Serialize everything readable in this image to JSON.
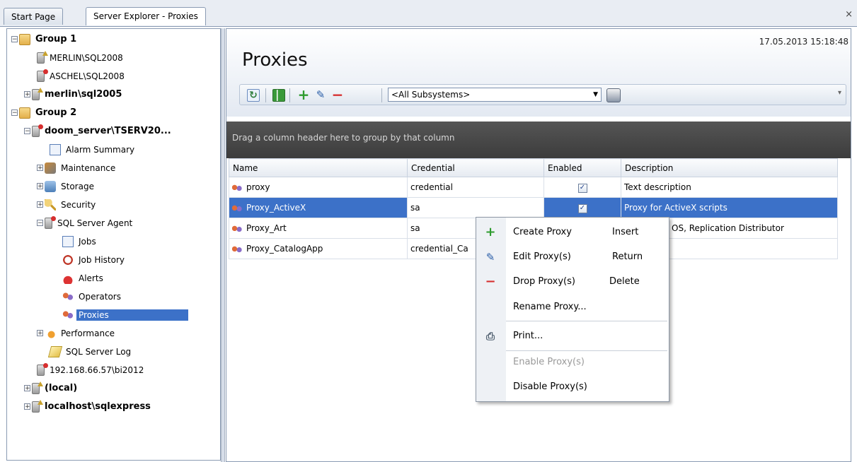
{
  "tabs": [
    {
      "label": "Start Page"
    },
    {
      "label": "Server Explorer - Proxies"
    }
  ],
  "close_glyph": "×",
  "tree": {
    "nodes": [
      {
        "label": "Group 1",
        "icon": "folder-icon",
        "bold": true,
        "expander": "−"
      },
      {
        "label": "MERLIN\\SQL2008",
        "icon": "server-icon",
        "bold": false
      },
      {
        "label": "ASCHEL\\SQL2008",
        "icon": "server-error-icon",
        "bold": false
      },
      {
        "label": "merlin\\sql2005",
        "icon": "server-icon",
        "bold": true,
        "expander": "+"
      },
      {
        "label": "Group 2",
        "icon": "folder-icon",
        "bold": true,
        "expander": "−"
      },
      {
        "label": "doom_server\\TSERV20...",
        "icon": "server-error-icon",
        "bold": true,
        "expander": "−"
      },
      {
        "label": "Alarm Summary",
        "icon": "alarm-summary-icon",
        "bold": false
      },
      {
        "label": "Maintenance",
        "icon": "wrench-icon",
        "bold": false,
        "expander": "+"
      },
      {
        "label": "Storage",
        "icon": "storage-icon",
        "bold": false,
        "expander": "+"
      },
      {
        "label": "Security",
        "icon": "key-icon",
        "bold": false,
        "expander": "+"
      },
      {
        "label": "SQL Server Agent",
        "icon": "agent-icon",
        "bold": false,
        "expander": "−"
      },
      {
        "label": "Jobs",
        "icon": "jobs-icon",
        "bold": false
      },
      {
        "label": "Job History",
        "icon": "job-history-icon",
        "bold": false
      },
      {
        "label": "Alerts",
        "icon": "alert-icon",
        "bold": false
      },
      {
        "label": "Operators",
        "icon": "operators-icon",
        "bold": false
      },
      {
        "label": "Proxies",
        "icon": "proxies-icon",
        "bold": false,
        "selected": true
      },
      {
        "label": "Performance",
        "icon": "performance-icon",
        "bold": false,
        "expander": "+"
      },
      {
        "label": "SQL Server Log",
        "icon": "log-icon",
        "bold": false
      },
      {
        "label": "192.168.66.57\\bi2012",
        "icon": "server-error-icon",
        "bold": false
      },
      {
        "label": "(local)",
        "icon": "server-icon",
        "bold": true,
        "expander": "+"
      },
      {
        "label": "localhost\\sqlexpress",
        "icon": "server-icon",
        "bold": true,
        "expander": "+"
      }
    ]
  },
  "header": {
    "title": "Proxies",
    "timestamp": "17.05.2013 15:18:48"
  },
  "toolbar": {
    "refresh_icon": "refresh-icon",
    "columns_icon": "grid-columns-icon",
    "add_glyph": "+",
    "edit_glyph": "✎",
    "drop_glyph": "−",
    "subsystem_value": "<All Subsystems>",
    "dropdown_glyph": "▼",
    "print_icon": "printer-icon",
    "more_glyph": "▾"
  },
  "grid": {
    "group_hint": "Drag a column header here to group by that column",
    "columns": [
      "Name",
      "Credential",
      "Enabled",
      "Description"
    ],
    "rows": [
      {
        "name": "proxy",
        "credential": "credential",
        "enabled": true,
        "description": "Text description"
      },
      {
        "name": "Proxy_ActiveX",
        "credential": "sa",
        "enabled": true,
        "description": "Proxy for ActiveX scripts",
        "selected": true
      },
      {
        "name": "Proxy_Art",
        "credential": "sa",
        "enabled": null,
        "description": "OS, Replication Distributor"
      },
      {
        "name": "Proxy_CatalogApp",
        "credential": "credential_Ca",
        "enabled": null,
        "description": ""
      }
    ],
    "check_glyph": "✓"
  },
  "context_menu": {
    "items": [
      {
        "label": "Create Proxy",
        "shortcut": "Insert",
        "icon_glyph": "+",
        "icon_color": "#2e9b2e"
      },
      {
        "label": "Edit Proxy(s)",
        "shortcut": "Return",
        "icon_glyph": "✎",
        "icon_color": "#2a5ea8"
      },
      {
        "label": "Drop Proxy(s)",
        "shortcut": "Delete",
        "icon_glyph": "−",
        "icon_color": "#d62e2e"
      },
      {
        "label": "Rename Proxy...",
        "shortcut": ""
      },
      {
        "label": "Print...",
        "shortcut": "",
        "icon_glyph": "⎙",
        "icon_color": "#506070"
      },
      {
        "label": "Enable Proxy(s)",
        "shortcut": "",
        "disabled": true
      },
      {
        "label": "Disable Proxy(s)",
        "shortcut": ""
      }
    ]
  },
  "colors": {
    "selection": "#3c71c8",
    "group_panel": "#3c3c3c",
    "add_green": "#2e9b2e",
    "drop_red": "#d62e2e"
  }
}
